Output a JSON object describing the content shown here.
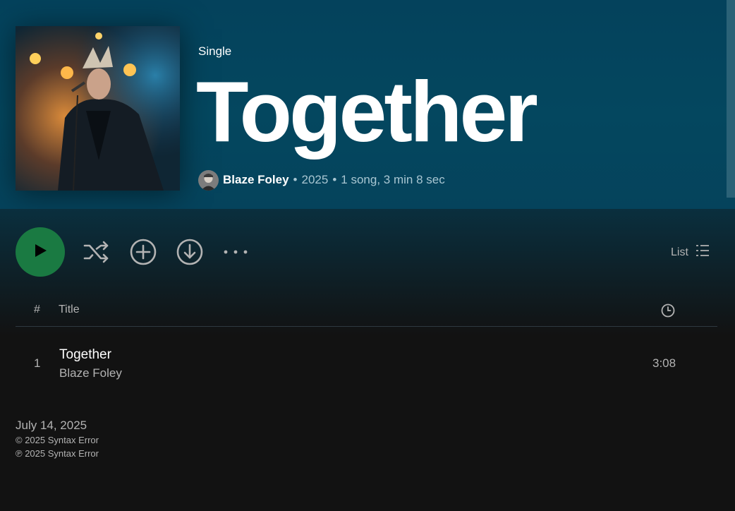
{
  "album": {
    "type": "Single",
    "title": "Together",
    "artist": "Blaze Foley",
    "year": "2025",
    "summary": "1 song, 3 min 8 sec",
    "dot": "•"
  },
  "controls": {
    "list_label": "List"
  },
  "table": {
    "num_header": "#",
    "title_header": "Title"
  },
  "tracks": [
    {
      "num": "1",
      "title": "Together",
      "artist": "Blaze Foley",
      "duration": "3:08"
    }
  ],
  "footer": {
    "release_date": "July 14, 2025",
    "copyright_c": "© 2025 Syntax Error",
    "copyright_p": "℗ 2025 Syntax Error"
  },
  "icons": {
    "play": "play-icon",
    "shuffle": "shuffle-icon",
    "add": "add-circle-icon",
    "download": "download-icon",
    "more": "more-icon",
    "list": "list-view-icon",
    "clock": "clock-icon"
  },
  "colors": {
    "header_bg": "#04475f",
    "play_green": "#1a7a42",
    "background": "#121212"
  }
}
